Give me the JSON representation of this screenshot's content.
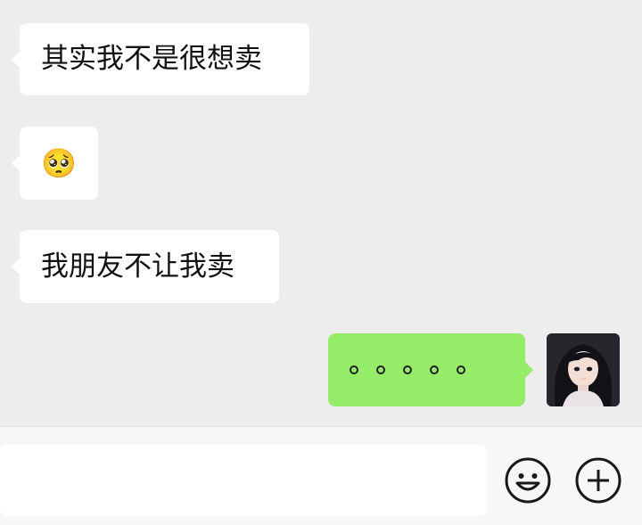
{
  "messages": [
    {
      "direction": "incoming",
      "text": "其实我不是很想卖"
    },
    {
      "direction": "incoming",
      "emoji": "🥺",
      "emoji_name": "pleading-face-icon"
    },
    {
      "direction": "incoming",
      "text": "我朋友不让我卖"
    },
    {
      "direction": "outgoing",
      "text": "。。。。。"
    }
  ],
  "composer": {
    "input_value": ""
  },
  "icons": {
    "emoji_button": "smiley-face-icon",
    "more_button": "plus-circle-icon"
  },
  "colors": {
    "background": "#ededed",
    "incoming_bubble": "#ffffff",
    "outgoing_bubble": "#95ec69",
    "composer_bg": "#f7f7f7"
  }
}
